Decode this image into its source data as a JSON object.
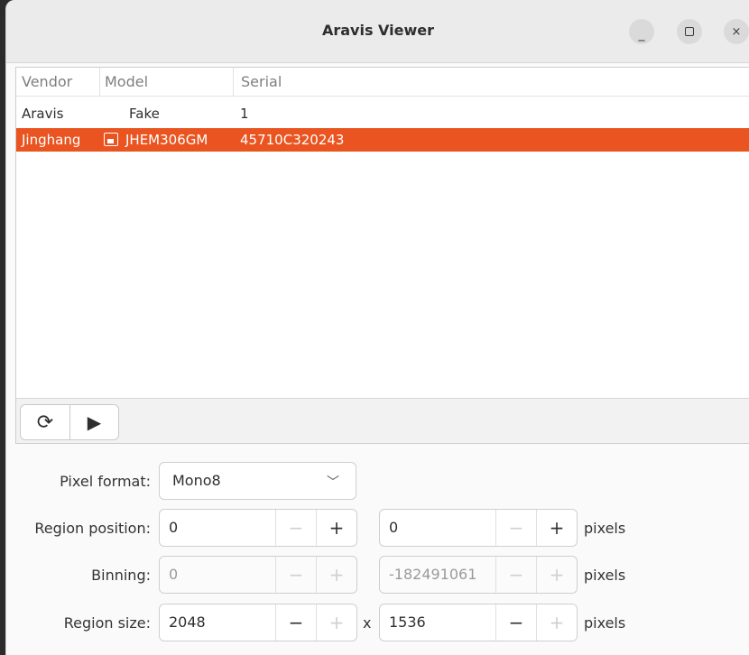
{
  "window": {
    "title": "Aravis Viewer",
    "min_glyph": "_",
    "close_glyph": "×"
  },
  "camera_list": {
    "columns": [
      "Vendor",
      "Model",
      "Serial"
    ],
    "rows": [
      {
        "vendor": "Aravis",
        "model": "Fake",
        "serial": "1",
        "selected": false,
        "icon": ""
      },
      {
        "vendor": "Jinghang",
        "model": "JHEM306GM",
        "serial": "45710C320243",
        "selected": true,
        "icon": "network-camera-icon"
      }
    ],
    "refresh_glyph": "⟳",
    "play_glyph": "▶"
  },
  "settings": {
    "pixel_format_label": "Pixel format:",
    "pixel_format_value": "Mono8",
    "region_position_label": "Region position:",
    "region_position_x": "0",
    "region_position_y": "0",
    "binning_label": "Binning:",
    "binning_x": "0",
    "binning_y": "-182491061",
    "region_size_label": "Region size:",
    "region_size_x": "2048",
    "region_size_y": "1536",
    "size_separator": "x",
    "unit": "pixels",
    "minus_glyph": "−",
    "plus_glyph": "+",
    "chevron_glyph": "﹀"
  },
  "colors": {
    "selection": "#e95420"
  }
}
